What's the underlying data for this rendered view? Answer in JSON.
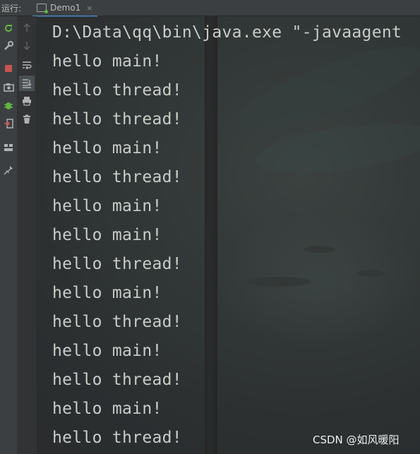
{
  "header": {
    "run_label": "运行:",
    "tab_label": "Demo1",
    "tab_close": "×"
  },
  "toolbar_left": {
    "icons": [
      "rerun-icon",
      "wrench-icon",
      "stop-icon",
      "camera-icon",
      "debug-bug-icon",
      "exit-icon",
      "layout-icon",
      "pin-icon"
    ]
  },
  "toolbar_right": {
    "icons": [
      "up-arrow-icon",
      "down-arrow-icon",
      "soft-wrap-icon",
      "scroll-to-end-icon",
      "print-icon",
      "trash-icon"
    ]
  },
  "console": {
    "lines": [
      "D:\\Data\\qq\\bin\\java.exe \"-javaagent",
      "hello main!",
      "hello thread!",
      "hello thread!",
      "hello main!",
      "hello thread!",
      "hello main!",
      "hello main!",
      "hello thread!",
      "hello main!",
      "hello thread!",
      "hello main!",
      "hello thread!",
      "hello main!",
      "hello thread!"
    ]
  },
  "watermark": "CSDN @如风暖阳",
  "colors": {
    "toolbar_bg": "#3c3f41",
    "console_text": "#c9cdc9",
    "rerun_green": "#62b543",
    "stop_red": "#c75450",
    "tab_underline": "#4a88c7"
  }
}
